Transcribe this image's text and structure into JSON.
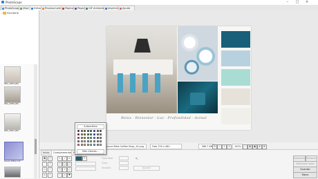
{
  "window": {
    "title": "PhotoScape"
  },
  "tabs": [
    {
      "label": "PhotoScape",
      "color": "#4a8fd8"
    },
    {
      "label": "Visor",
      "color": "#6aa84f"
    },
    {
      "label": "Editor",
      "color": "#3d85c6"
    },
    {
      "label": "Proceso Lotes",
      "color": "#e69138"
    },
    {
      "label": "Página",
      "color": "#cc4125"
    },
    {
      "label": "Pegar",
      "color": "#674ea7"
    },
    {
      "label": "GIF Animado",
      "color": "#45818e"
    },
    {
      "label": "Imprimir",
      "color": "#3c78d8"
    },
    {
      "label": "Ayuda",
      "color": "#e06666"
    }
  ],
  "tree": {
    "folder": "Escritorio"
  },
  "thumbnails": [
    {
      "label": "IMG_2663.JPG"
    },
    {
      "label": "IMG_2666.JPG"
    },
    {
      "label": "IMG_2667.JPG"
    },
    {
      "label": "Sauce Mate Cof"
    }
  ],
  "caption": "Relax - Bienestar - Luz - Profundidad - Actual",
  "status": {
    "filename": "Sauce Mate Coffee Shop_10.png",
    "dimensions": "Foto 700 x 460",
    "filesize": "386.7 KB",
    "zoom": "100%"
  },
  "bottom_tabs": [
    "Inicio",
    "Complementos",
    "Herr."
  ],
  "properties": {
    "opacity": "Opacidad",
    "rotate": "Girar",
    "size": "Tamaño",
    "apply": "Ajustar"
  },
  "right_buttons": {
    "undo": "Deshacer",
    "redo": "Rehacer",
    "undo_all": "Deshacer todo",
    "save": "Guardar",
    "menu": "Menú"
  },
  "color_popup": {
    "auto_label": "Automático",
    "more_label": "Más Colores..."
  },
  "palette": {
    "swatches": [
      "#1a5f7a",
      "#b7d2de",
      "#a9ddd4",
      "#e6e2da",
      "#f1efe9"
    ]
  }
}
